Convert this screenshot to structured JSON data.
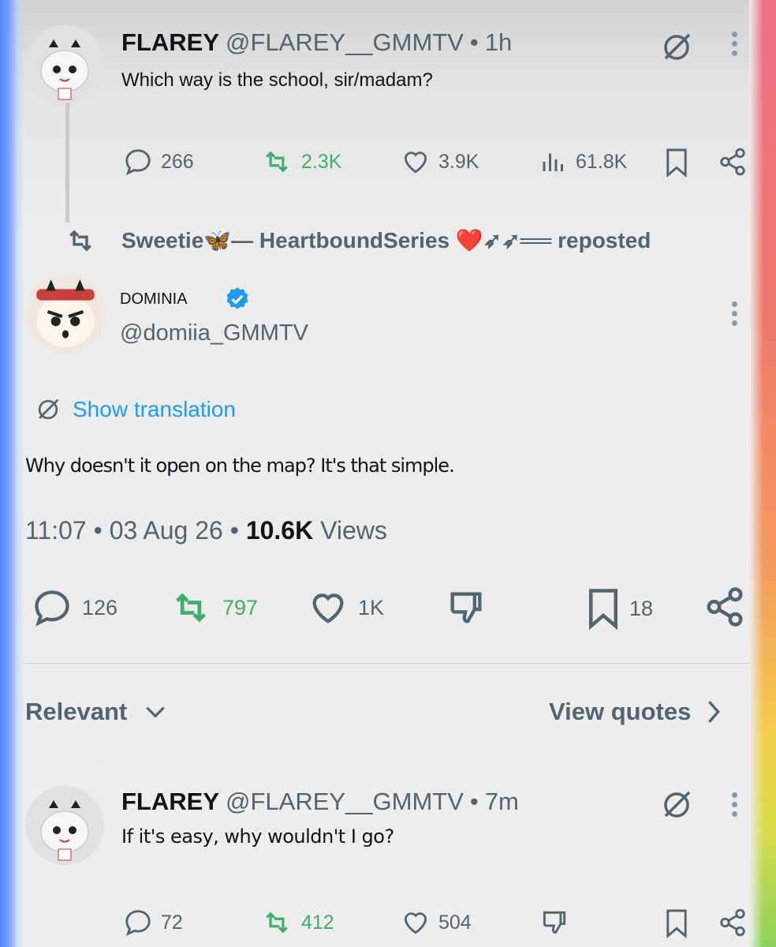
{
  "tweet1": {
    "display_name": "FLAREY",
    "handle": "@FLAREY__GMMTV",
    "time": "1h",
    "text": "Which way is the school, sir/madam?",
    "replies": "266",
    "reposts": "2.3K",
    "likes": "3.9K",
    "views": "61.8K"
  },
  "repost_line": {
    "name": "Sweetie🦋— HeartboundSeries ❤️➶➶══",
    "suffix": "reposted"
  },
  "main_tweet": {
    "display_name": "DOMINIA",
    "handle": "@domiia_GMMTV",
    "show_translation": "Show translation",
    "text": "Why doesn't it open on the map? It's that simple.",
    "time": "11:07",
    "date": "03 Aug 26",
    "views_count": "10.6K",
    "views_label": "Views",
    "replies": "126",
    "reposts": "797",
    "likes": "1K",
    "bookmarks": "18"
  },
  "filter": {
    "sort_label": "Relevant",
    "view_quotes": "View quotes"
  },
  "reply": {
    "display_name": "FLAREY",
    "handle": "@FLAREY__GMMTV",
    "time": "7m",
    "text": "If it's easy, why wouldn't I go?",
    "replies": "72",
    "reposts": "412",
    "likes": "504"
  },
  "colors": {
    "link": "#1d9bf0",
    "repost_green": "#3fae6b",
    "muted": "#536471",
    "verified": "#1d9bf0"
  }
}
